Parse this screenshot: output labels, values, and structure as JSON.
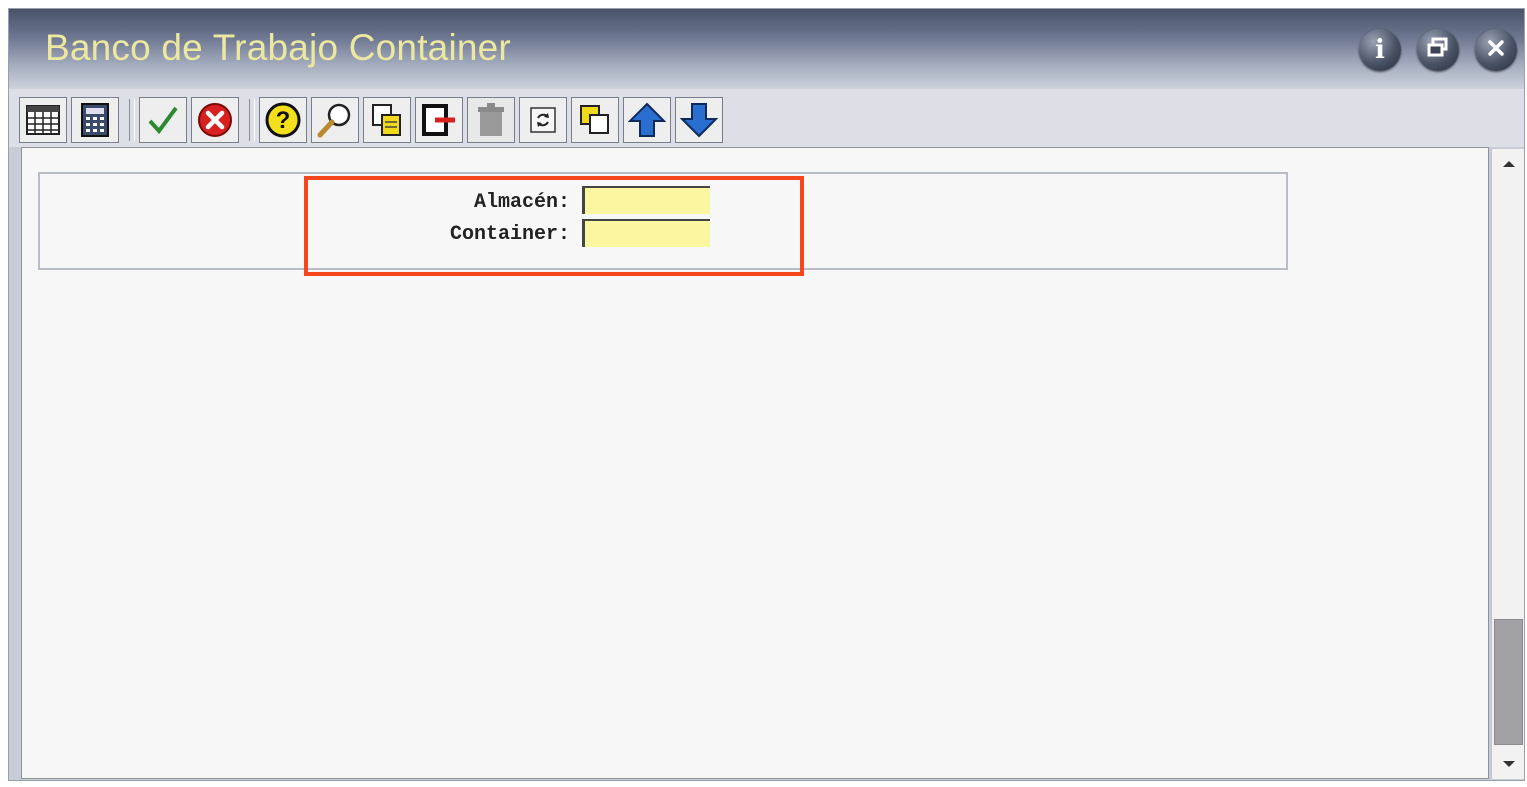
{
  "window": {
    "title": "Banco de Trabajo Container",
    "controls": [
      "info-icon",
      "restore-icon",
      "close-icon"
    ],
    "title_color": "#ece8a0"
  },
  "toolbar": {
    "buttons": [
      "table-grid-icon",
      "calculator-icon",
      "checkmark-icon",
      "cancel-icon",
      "help-icon",
      "search-icon",
      "copy-record-icon",
      "exit-icon",
      "delete-icon",
      "refresh-icon",
      "duplicate-icon",
      "arrow-up-icon",
      "arrow-down-icon"
    ]
  },
  "form": {
    "fields": [
      {
        "label": "Almacén:",
        "value": ""
      },
      {
        "label": "Container:",
        "value": ""
      }
    ],
    "field_bg": "#fbf6a0",
    "highlight_color": "#f5461e"
  },
  "scrollbar": {
    "up_icon": "scroll-up-arrow-icon",
    "down_icon": "scroll-down-arrow-icon"
  }
}
